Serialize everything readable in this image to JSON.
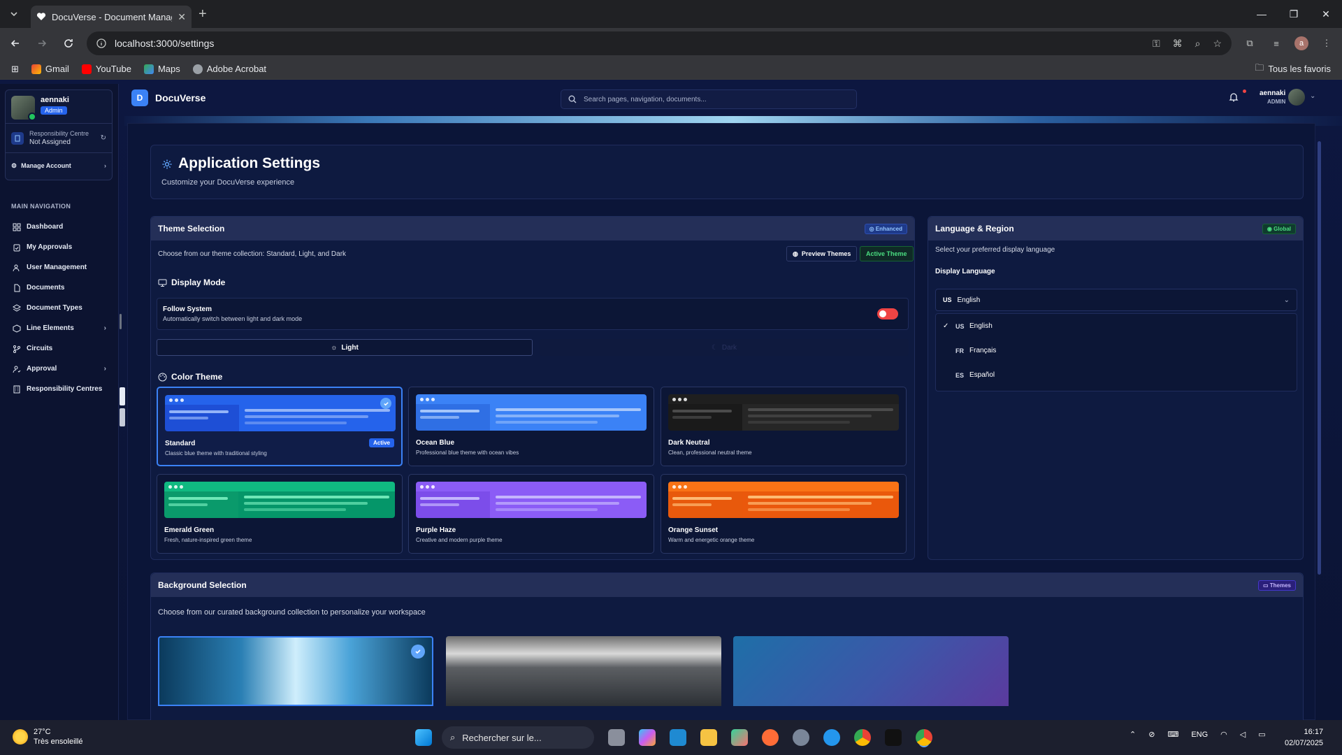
{
  "browser": {
    "tab_title": "DocuVerse - Document Management",
    "url": "localhost:3000/settings",
    "profile_initial": "a",
    "bookmarks": [
      "Gmail",
      "YouTube",
      "Maps",
      "Adobe Acrobat"
    ],
    "all_bookmarks": "Tous les favoris"
  },
  "sidebar": {
    "user_name": "aennaki",
    "role_badge": "Admin",
    "resp_title": "Responsibility Centre",
    "resp_value": "Not Assigned",
    "manage_account": "Manage Account",
    "section_label": "MAIN NAVIGATION",
    "items": [
      {
        "label": "Dashboard",
        "icon": "dashboard-icon",
        "has_children": false
      },
      {
        "label": "My Approvals",
        "icon": "clipboard-check-icon",
        "has_children": false
      },
      {
        "label": "User Management",
        "icon": "users-icon",
        "has_children": false
      },
      {
        "label": "Documents",
        "icon": "document-icon",
        "has_children": false
      },
      {
        "label": "Document Types",
        "icon": "layers-icon",
        "has_children": false
      },
      {
        "label": "Line Elements",
        "icon": "box-icon",
        "has_children": true
      },
      {
        "label": "Circuits",
        "icon": "branch-icon",
        "has_children": false
      },
      {
        "label": "Approval",
        "icon": "user-check-icon",
        "has_children": true
      },
      {
        "label": "Responsibility Centres",
        "icon": "building-icon",
        "has_children": false
      }
    ]
  },
  "topbar": {
    "logo_letter": "D",
    "brand": "DocuVerse",
    "search_placeholder": "Search pages, navigation, documents...",
    "user_name": "aennaki",
    "user_role": "ADMIN"
  },
  "header": {
    "title": "Application Settings",
    "subtitle": "Customize your DocuVerse experience"
  },
  "theme": {
    "title": "Theme Selection",
    "badge": "Enhanced",
    "description": "Choose from our theme collection: Standard, Light, and Dark",
    "preview_button": "Preview Themes",
    "active_button": "Active Theme",
    "display_mode_title": "Display Mode",
    "follow_title": "Follow System",
    "follow_desc": "Automatically switch between light and dark mode",
    "follow_enabled": true,
    "mode_light": "Light",
    "mode_dark": "Dark",
    "color_theme_title": "Color Theme",
    "cards": [
      {
        "name": "Standard",
        "desc": "Classic blue theme with traditional styling",
        "active": true,
        "header": "#2563eb",
        "left": "#1e4fd6",
        "right": "#2563eb",
        "line": "#93b4f8"
      },
      {
        "name": "Ocean Blue",
        "desc": "Professional blue theme with ocean vibes",
        "active": false,
        "header": "#3b82f6",
        "left": "#2f6fe4",
        "right": "#3b82f6",
        "line": "#a5c6fb"
      },
      {
        "name": "Dark Neutral",
        "desc": "Clean, professional neutral theme",
        "active": false,
        "header": "#1f1f1f",
        "left": "#1a1a1a",
        "right": "#262626",
        "line": "#4b4b4b"
      },
      {
        "name": "Emerald Green",
        "desc": "Fresh, nature-inspired green theme",
        "active": false,
        "header": "#10b981",
        "left": "#0a9a6b",
        "right": "#059669",
        "line": "#6ee7b7"
      },
      {
        "name": "Purple Haze",
        "desc": "Creative and modern purple theme",
        "active": false,
        "header": "#8b5cf6",
        "left": "#7c4dea",
        "right": "#8b5cf6",
        "line": "#c4b5fd"
      },
      {
        "name": "Orange Sunset",
        "desc": "Warm and energetic orange theme",
        "active": false,
        "header": "#f97316",
        "left": "#e8590c",
        "right": "#ea580c",
        "line": "#fdba74"
      }
    ],
    "active_label": "Active"
  },
  "language": {
    "title": "Language & Region",
    "badge": "Global",
    "description": "Select your preferred display language",
    "field_label": "Display Language",
    "selected_code": "US",
    "selected_name": "English",
    "options": [
      {
        "code": "US",
        "name": "English",
        "selected": true
      },
      {
        "code": "FR",
        "name": "Français",
        "selected": false
      },
      {
        "code": "ES",
        "name": "Español",
        "selected": false
      }
    ]
  },
  "background": {
    "title": "Background Selection",
    "badge": "Themes",
    "description": "Choose from our curated background collection to personalize your workspace"
  },
  "taskbar": {
    "temp": "27°C",
    "weather": "Très ensoleillé",
    "search": "Rechercher sur le...",
    "lang": "ENG",
    "time": "16:17",
    "date": "02/07/2025"
  },
  "colors": {
    "accent": "#3b82f6",
    "toggle_on": "#ef4444",
    "active_theme_green": "#22c55e"
  }
}
